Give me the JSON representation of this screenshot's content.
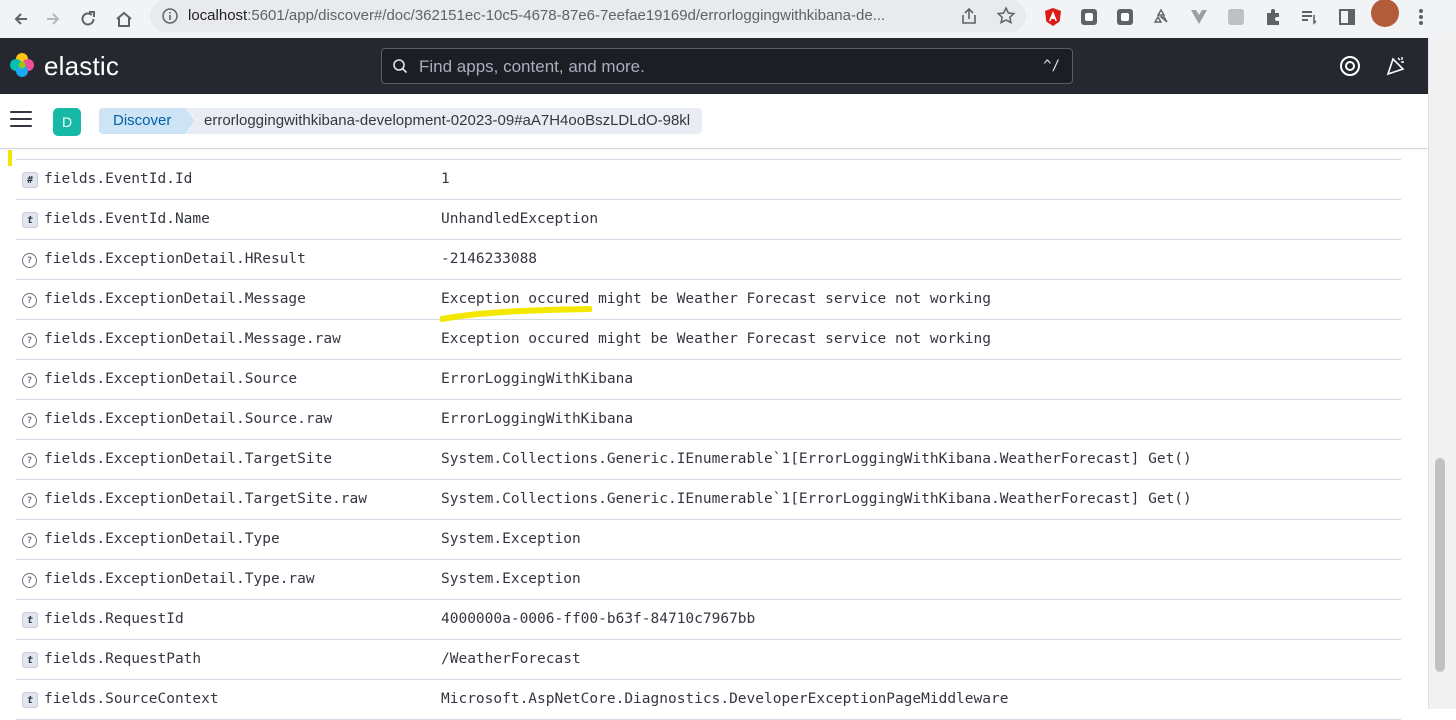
{
  "browser": {
    "url_host": "localhost",
    "url_rest": ":5601/app/discover#/doc/362151ec-10c5-4678-87e6-7eefae19169d/errorloggingwithkibana-de..."
  },
  "header": {
    "logo_text": "elastic",
    "search_placeholder": "Find apps, content, and more.",
    "search_shortcut": "^/"
  },
  "subheader": {
    "space_initial": "D",
    "breadcrumb_app": "Discover",
    "breadcrumb_doc": "errorloggingwithkibana-development-02023-09#aA7H4ooBszLDLdO-98kl"
  },
  "fields": [
    {
      "type": "number",
      "icon_text": "#",
      "name": "fields.EventId.Id",
      "value": "1"
    },
    {
      "type": "text",
      "icon_text": "t",
      "name": "fields.EventId.Name",
      "value": "UnhandledException"
    },
    {
      "type": "unknown",
      "icon_text": "?",
      "name": "fields.ExceptionDetail.HResult",
      "value": "-2146233088"
    },
    {
      "type": "unknown",
      "icon_text": "?",
      "name": "fields.ExceptionDetail.Message",
      "value": "Exception occured might be Weather Forecast service not working"
    },
    {
      "type": "unknown",
      "icon_text": "?",
      "name": "fields.ExceptionDetail.Message.raw",
      "value": "Exception occured might be Weather Forecast service not working"
    },
    {
      "type": "unknown",
      "icon_text": "?",
      "name": "fields.ExceptionDetail.Source",
      "value": "ErrorLoggingWithKibana"
    },
    {
      "type": "unknown",
      "icon_text": "?",
      "name": "fields.ExceptionDetail.Source.raw",
      "value": "ErrorLoggingWithKibana"
    },
    {
      "type": "unknown",
      "icon_text": "?",
      "name": "fields.ExceptionDetail.TargetSite",
      "value": "System.Collections.Generic.IEnumerable`1[ErrorLoggingWithKibana.WeatherForecast] Get()"
    },
    {
      "type": "unknown",
      "icon_text": "?",
      "name": "fields.ExceptionDetail.TargetSite.raw",
      "value": "System.Collections.Generic.IEnumerable`1[ErrorLoggingWithKibana.WeatherForecast] Get()"
    },
    {
      "type": "unknown",
      "icon_text": "?",
      "name": "fields.ExceptionDetail.Type",
      "value": "System.Exception"
    },
    {
      "type": "unknown",
      "icon_text": "?",
      "name": "fields.ExceptionDetail.Type.raw",
      "value": "System.Exception"
    },
    {
      "type": "text",
      "icon_text": "t",
      "name": "fields.RequestId",
      "value": "4000000a-0006-ff00-b63f-84710c7967bb"
    },
    {
      "type": "text",
      "icon_text": "t",
      "name": "fields.RequestPath",
      "value": "/WeatherForecast"
    },
    {
      "type": "text",
      "icon_text": "t",
      "name": "fields.SourceContext",
      "value": "Microsoft.AspNetCore.Diagnostics.DeveloperExceptionPageMiddleware"
    }
  ],
  "colors": {
    "header_bg": "#25282f",
    "breadcrumb_active_bg": "#cce4f5",
    "space_avatar": "#16b9a5",
    "annotation_highlight": "#f3e600"
  }
}
